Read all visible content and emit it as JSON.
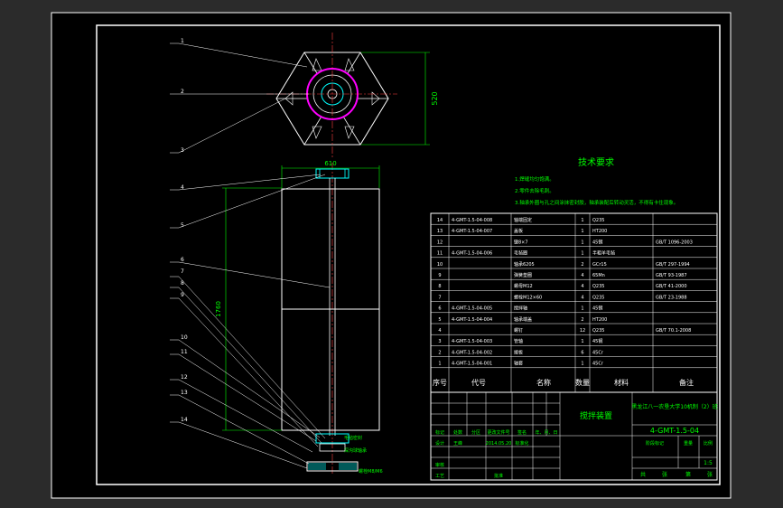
{
  "tech": {
    "title": "技术要求",
    "items": [
      "1.焊缝均匀饱满。",
      "2.零件去除毛刺。",
      "3.轴承外圈与孔之间涂抹密封胶，轴承装配后转动灵活，不得有卡住现象。"
    ]
  },
  "leaders": [
    "1",
    "2",
    "3",
    "4",
    "5",
    "6",
    "7",
    "8",
    "9",
    "10",
    "11",
    "12",
    "13",
    "14"
  ],
  "dims": {
    "width": "610",
    "height_top": "520",
    "height_total": "1760"
  },
  "small_labels": [
    "毛毡密封",
    "深沟球轴承",
    "螺栓M8/M6"
  ],
  "bom": {
    "rows": [
      {
        "no": "14",
        "code": "4-GMT-1.5-04-008",
        "name": "轴端固定",
        "qty": "1",
        "mat": "Q235",
        "std": ""
      },
      {
        "no": "13",
        "code": "4-GMT-1.5-04-007",
        "name": "盖板",
        "qty": "1",
        "mat": "HT200",
        "std": ""
      },
      {
        "no": "12",
        "code": "",
        "name": "键8×7",
        "qty": "1",
        "mat": "45钢",
        "std": "GB/T 1096-2003"
      },
      {
        "no": "11",
        "code": "4-GMT-1.5-04-006",
        "name": "毛毡圈",
        "qty": "1",
        "mat": "半粗羊毛毡",
        "std": ""
      },
      {
        "no": "10",
        "code": "",
        "name": "轴承6205",
        "qty": "2",
        "mat": "GCr15",
        "std": "GB/T 297-1994"
      },
      {
        "no": "9",
        "code": "",
        "name": "弹簧垫圈",
        "qty": "4",
        "mat": "65Mn",
        "std": "GB/T 93-1987"
      },
      {
        "no": "8",
        "code": "",
        "name": "螺母M12",
        "qty": "4",
        "mat": "Q235",
        "std": "GB/T 41-2000"
      },
      {
        "no": "7",
        "code": "",
        "name": "螺栓M12×60",
        "qty": "4",
        "mat": "Q235",
        "std": "GB/T 23-1988"
      },
      {
        "no": "6",
        "code": "4-GMT-1.5-04-005",
        "name": "搅拌轴",
        "qty": "1",
        "mat": "45钢",
        "std": ""
      },
      {
        "no": "5",
        "code": "4-GMT-1.5-04-004",
        "name": "轴承端盖",
        "qty": "2",
        "mat": "HT200",
        "std": ""
      },
      {
        "no": "4",
        "code": "",
        "name": "螺钉",
        "qty": "12",
        "mat": "Q235",
        "std": "GB/T 70.1-2008"
      },
      {
        "no": "3",
        "code": "4-GMT-1.5-04-003",
        "name": "管轴",
        "qty": "1",
        "mat": "45钢",
        "std": ""
      },
      {
        "no": "2",
        "code": "4-GMT-1.5-04-002",
        "name": "拨板",
        "qty": "6",
        "mat": "45Cr",
        "std": ""
      },
      {
        "no": "1",
        "code": "4-GMT-1.5-04-001",
        "name": "轴套",
        "qty": "1",
        "mat": "45Cr",
        "std": ""
      }
    ],
    "header": {
      "no": "序号",
      "code": "代号",
      "name": "名称",
      "qty": "数量",
      "mat": "材料",
      "std": "备注"
    }
  },
  "title_block": {
    "drawing_name": "搅拌装置",
    "org": "黑龙江八一农垦大学10机制（2）班",
    "drawing_no": "4-GMT-1.5-04",
    "row_labels": [
      "标记",
      "处数",
      "分区",
      "更改文件号",
      "签名",
      "年、月、日"
    ],
    "row2_labels": [
      "设计",
      "王峰",
      "2014.05.20",
      "标准化"
    ],
    "stage_labels": [
      "阶段标记",
      "重量",
      "比例"
    ],
    "scale": "1:5",
    "side_labels": [
      "审核",
      "工艺",
      "批准"
    ],
    "sheet_labels": [
      "共",
      "张",
      "第",
      "张"
    ]
  },
  "colors": {
    "bg": "#000000",
    "frame": "#ffffff",
    "line": "#ffffff",
    "dim": "#00ff00",
    "accent": "#ff00ff",
    "text": "#ffffff",
    "green": "#00ff00",
    "cyan": "#00ffff"
  }
}
